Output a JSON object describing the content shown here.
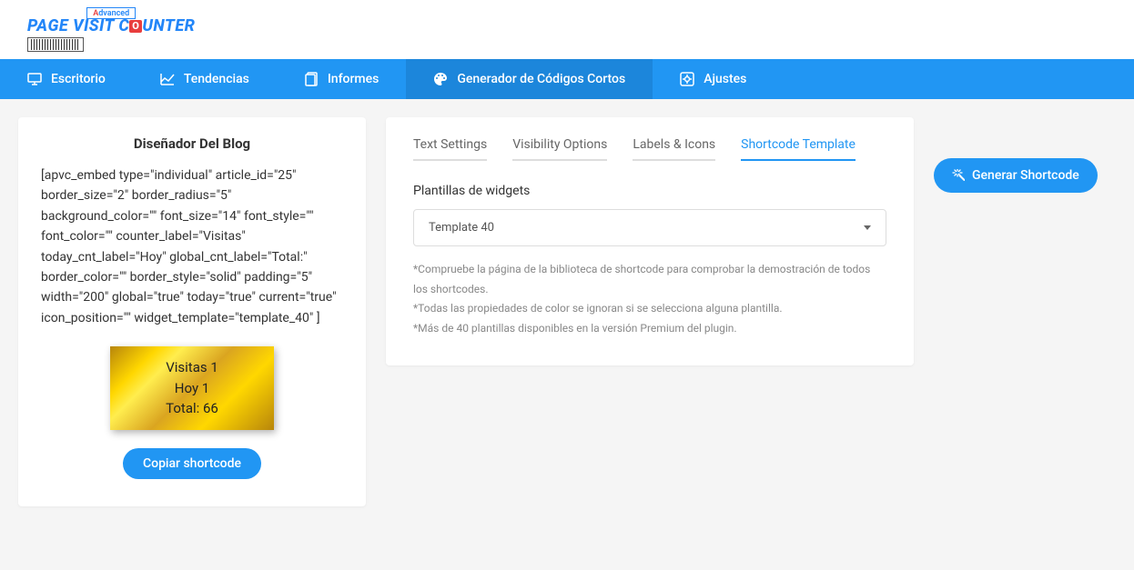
{
  "logo": {
    "top_letter": "A",
    "top_rest": "dvanced",
    "line1_a": "PAGE V",
    "line1_b": "ISIT C",
    "line1_c": "UNTER"
  },
  "nav": {
    "items": [
      {
        "label": "Escritorio",
        "icon": "desktop"
      },
      {
        "label": "Tendencias",
        "icon": "trend"
      },
      {
        "label": "Informes",
        "icon": "reports"
      },
      {
        "label": "Generador de Códigos Cortos",
        "icon": "palette"
      },
      {
        "label": "Ajustes",
        "icon": "gear"
      }
    ],
    "active_index": 3
  },
  "left": {
    "title": "Diseñador Del Blog",
    "shortcode": "[apvc_embed type=\"individual\" article_id=\"25\" border_size=\"2\" border_radius=\"5\" background_color=\"\" font_size=\"14\" font_style=\"\" font_color=\"\" counter_label=\"Visitas\" today_cnt_label=\"Hoy\" global_cnt_label=\"Total:\" border_color=\"\" border_style=\"solid\" padding=\"5\" width=\"200\" global=\"true\" today=\"true\" current=\"true\" icon_position=\"\" widget_template=\"template_40\" ]",
    "widget": {
      "line1": "Visitas 1",
      "line2": "Hoy 1",
      "line3": "Total: 66"
    },
    "copy_btn": "Copiar shortcode"
  },
  "right": {
    "tabs": [
      "Text Settings",
      "Visibility Options",
      "Labels & Icons",
      "Shortcode Template"
    ],
    "active_tab": 3,
    "section_label": "Plantillas de widgets",
    "select_value": "Template 40",
    "hints": [
      "*Compruebe la página de la biblioteca de shortcode para comprobar la demostración de todos los shortcodes.",
      "*Todas las propiedades de color se ignoran si se selecciona alguna plantilla.",
      "*Más de 40 plantillas disponibles en la versión Premium del plugin."
    ]
  },
  "generate_btn": "Generar Shortcode"
}
